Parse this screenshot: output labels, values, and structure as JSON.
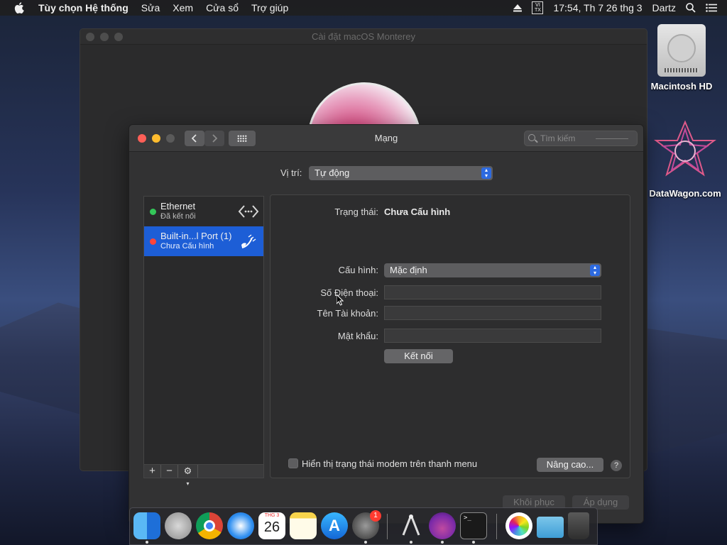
{
  "menubar": {
    "app_name": "Tùy chọn Hệ thống",
    "items": [
      "Sửa",
      "Xem",
      "Cửa sổ",
      "Trợ giúp"
    ],
    "input_source": "VI TX",
    "clock": "17:54, Th 7 26 thg 3",
    "user": "Dartz"
  },
  "background_window": {
    "title": "Cài đặt macOS Monterey"
  },
  "desktop": {
    "icons": [
      "Macintosh HD",
      "DataWagon.com"
    ]
  },
  "network_window": {
    "title": "Mạng",
    "search_placeholder": "Tìm kiếm",
    "location_label": "Vị trí:",
    "location_value": "Tự động",
    "services": [
      {
        "name": "Ethernet",
        "status": "Đã kết nối",
        "led_color": "#34c759",
        "icon": "ethernet-arrows-icon"
      },
      {
        "name": "Built-in...l Port (1)",
        "status": "Chưa Cấu hình",
        "led_color": "#ff453a",
        "icon": "phone-modem-icon",
        "selected": true
      }
    ],
    "list_controls": {
      "add": "+",
      "remove": "−",
      "gear": "⚙"
    },
    "detail": {
      "status_label": "Trạng thái:",
      "status_value": "Chưa Cấu hình",
      "config_label": "Cấu hình:",
      "config_value": "Mặc định",
      "phone_label": "Số Điện thoại:",
      "phone_value": "",
      "account_label": "Tên Tài khoản:",
      "account_value": "",
      "password_label": "Mật khẩu:",
      "password_value": "",
      "connect_button": "Kết nối"
    },
    "show_modem_status_label": "Hiển thị trạng thái modem trên thanh menu",
    "show_modem_status_checked": false,
    "advanced_button": "Nâng cao...",
    "help_button": "?",
    "revert_button": "Khôi phục",
    "apply_button": "Áp dụng"
  },
  "dock": {
    "apps": [
      "Finder",
      "Launchpad",
      "Chrome",
      "Safari",
      "Lịch",
      "Ghi chú",
      "App Store",
      "Tùy chọn Hệ thống",
      "Tiện ích",
      "Trình cài đặt",
      "Terminal",
      "Ảnh",
      "Thư mục",
      "Thùng rác"
    ],
    "calendar_month": "THG 3",
    "calendar_day": "26",
    "prefs_badge": "1"
  },
  "colors": {
    "selection_blue": "#1d5ed6",
    "accent_blue": "#2d6ae0",
    "close_red": "#fe5f57",
    "minimize_yellow": "#febc2e"
  }
}
